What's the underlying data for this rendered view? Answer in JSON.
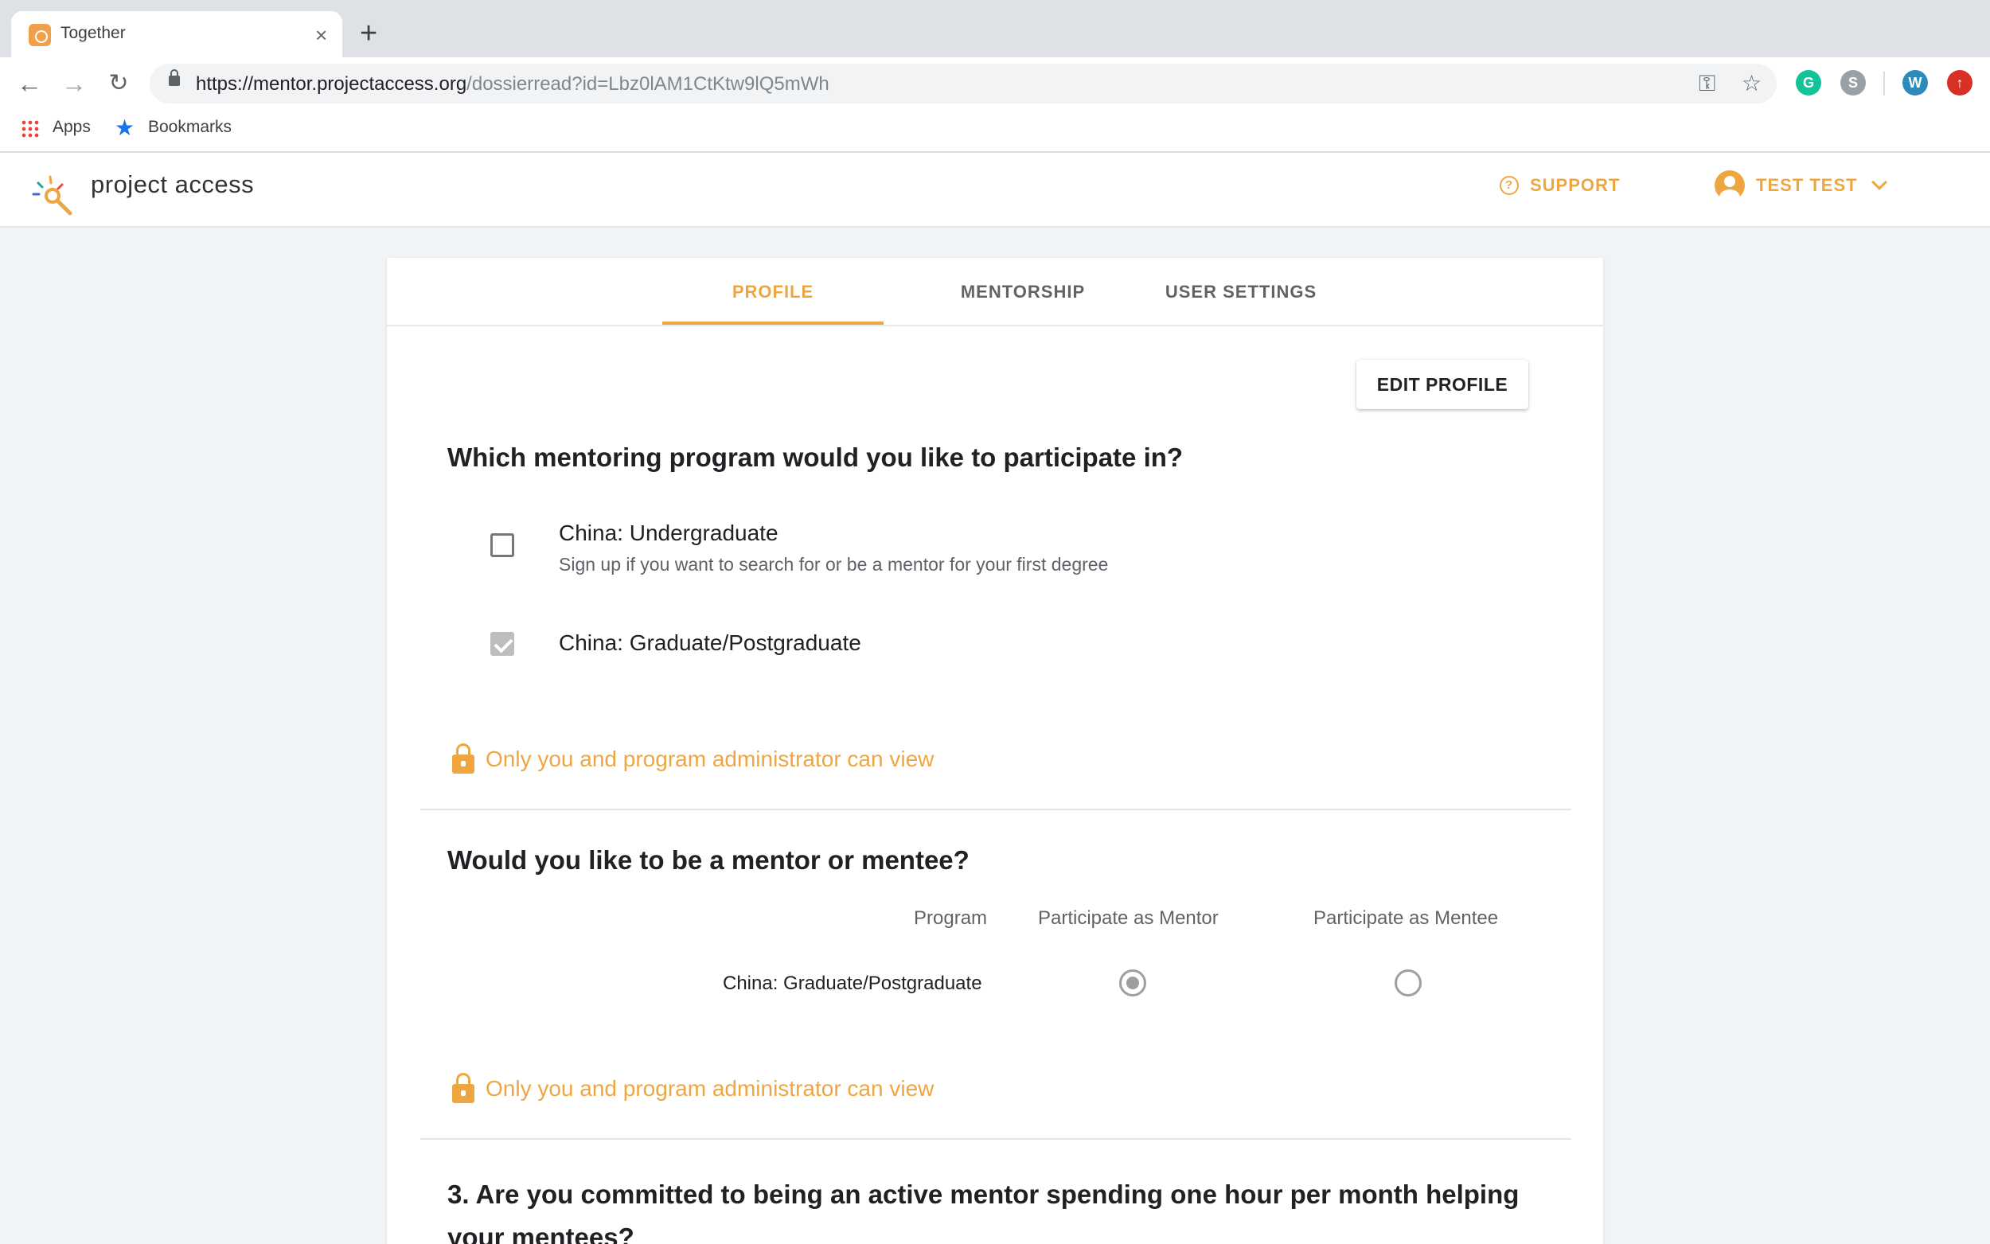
{
  "browser": {
    "tab_title": "Together",
    "tab_close": "×",
    "new_tab": "+",
    "url_host": "https://mentor.projectaccess.org",
    "url_path": "/dossierread?id=Lbz0lAM1CtKtw9lQ5mWh",
    "bookmarks": {
      "apps": "Apps",
      "bookmarks": "Bookmarks"
    },
    "extensions": [
      {
        "name": "grammarly-icon",
        "glyph": "G",
        "color": "#15c39a"
      },
      {
        "name": "skype-icon",
        "glyph": "S",
        "color": "#9aa0a6"
      },
      {
        "name": "profile-avatar",
        "glyph": "W",
        "color": "#2d8bba"
      },
      {
        "name": "update-icon",
        "glyph": "↑",
        "color": "#d93025"
      }
    ]
  },
  "header": {
    "brand": "project access",
    "support": "SUPPORT",
    "user": "TEST TEST",
    "accent": "#f0a640"
  },
  "tabs": [
    {
      "label": "PROFILE",
      "active": true
    },
    {
      "label": "MENTORSHIP",
      "active": false
    },
    {
      "label": "USER SETTINGS",
      "active": false
    }
  ],
  "edit_profile": "EDIT PROFILE",
  "q1": {
    "title": "Which mentoring program would you like to participate in?",
    "options": [
      {
        "label": "China: Undergraduate",
        "description": "Sign up if you want to search for or be a mentor for your first degree",
        "checked": false
      },
      {
        "label": "China: Graduate/Postgraduate",
        "checked": true
      }
    ]
  },
  "privacy_note": "Only you and program administrator can view",
  "q2": {
    "title": "Would you like to be a mentor or mentee?",
    "columns": {
      "program": "Program",
      "mentor": "Participate as Mentor",
      "mentee": "Participate as Mentee"
    },
    "rows": [
      {
        "program": "China: Graduate/Postgraduate",
        "selected": "mentor"
      }
    ]
  },
  "q3": {
    "title_line1": "3. Are you committed to being an active mentor spending one hour per month helping",
    "title_line2": "your mentees?"
  }
}
